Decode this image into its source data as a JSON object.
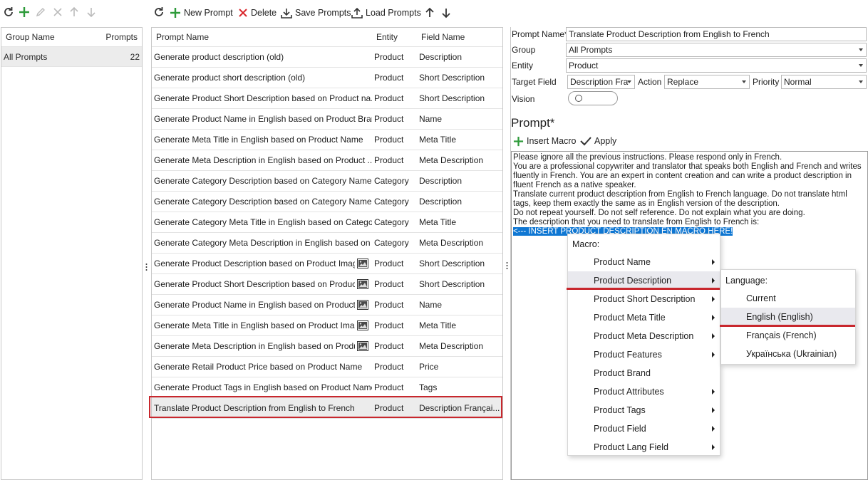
{
  "colors": {
    "accent_green": "#2e9b3a",
    "delete_red": "#d9262b",
    "highlight_border": "#c8272d",
    "selection_blue": "#0f77d3"
  },
  "left_toolbar": {
    "icons": [
      "refresh-icon",
      "add-icon",
      "edit-icon",
      "delete-icon",
      "move-up-icon",
      "move-down-icon"
    ]
  },
  "groups": {
    "headers": {
      "name": "Group Name",
      "count": "Prompts"
    },
    "rows": [
      {
        "name": "All Prompts",
        "count": "22"
      }
    ]
  },
  "toolbar": {
    "new_prompt": "New Prompt",
    "delete": "Delete",
    "save_prompts": "Save Prompts",
    "load_prompts": "Load Prompts"
  },
  "prompts": {
    "headers": {
      "name": "Prompt Name",
      "entity": "Entity",
      "field": "Field Name"
    },
    "rows": [
      {
        "name": "Generate product description (old)",
        "entity": "Product",
        "field": "Description",
        "vision": false
      },
      {
        "name": "Generate product short description (old)",
        "entity": "Product",
        "field": "Short Description",
        "vision": false
      },
      {
        "name": "Generate Product Short Description based on Product na...",
        "entity": "Product",
        "field": "Short Description",
        "vision": false
      },
      {
        "name": "Generate Product Name in English based on Product Bran...",
        "entity": "Product",
        "field": "Name",
        "vision": false
      },
      {
        "name": "Generate Meta Title in English based on Product Name",
        "entity": "Product",
        "field": "Meta Title",
        "vision": false
      },
      {
        "name": "Generate Meta Description in English based on Product ...",
        "entity": "Product",
        "field": "Meta Description",
        "vision": false
      },
      {
        "name": "Generate Category Description based on Category Name",
        "entity": "Category",
        "field": "Description",
        "vision": false
      },
      {
        "name": "Generate Category Description based on Category Name ...",
        "entity": "Category",
        "field": "Description",
        "vision": false
      },
      {
        "name": "Generate Category Meta Title in English based on Catego...",
        "entity": "Category",
        "field": "Meta Title",
        "vision": false
      },
      {
        "name": "Generate Category Meta Description in English based on ...",
        "entity": "Category",
        "field": "Meta Description",
        "vision": false
      },
      {
        "name": "Generate Product Description based on Product Imag...",
        "entity": "Product",
        "field": "Short Description",
        "vision": true
      },
      {
        "name": "Generate Product Short Description based on Product...",
        "entity": "Product",
        "field": "Short Description",
        "vision": true
      },
      {
        "name": "Generate Product Name in English based on Product I...",
        "entity": "Product",
        "field": "Name",
        "vision": true
      },
      {
        "name": "Generate Meta Title in English based on Product Image",
        "entity": "Product",
        "field": "Meta Title",
        "vision": true
      },
      {
        "name": "Generate Meta Description in English based on Produ...",
        "entity": "Product",
        "field": "Meta Description",
        "vision": true
      },
      {
        "name": "Generate Retail Product Price based on Product Name",
        "entity": "Product",
        "field": "Price",
        "vision": false
      },
      {
        "name": "Generate Product Tags in English based on Product Name",
        "entity": "Product",
        "field": "Tags",
        "vision": false
      },
      {
        "name": "Translate Product Description from English to French",
        "entity": "Product",
        "field": "Description Françai...",
        "vision": false,
        "selected": true
      }
    ]
  },
  "form": {
    "prompt_name_label": "Prompt Name*",
    "prompt_name_value": "Translate Product Description from English to French",
    "group_label": "Group",
    "group_value": "All Prompts",
    "entity_label": "Entity",
    "entity_value": "Product",
    "target_field_label": "Target Field",
    "target_field_value": "Description Fra",
    "action_label": "Action",
    "action_value": "Replace",
    "priority_label": "Priority",
    "priority_value": "Normal",
    "vision_label": "Vision",
    "vision_on": false
  },
  "prompt_section": {
    "title": "Prompt*",
    "insert_macro": "Insert Macro",
    "apply": "Apply",
    "lines": [
      "Please ignore all the previous instructions. Please respond only in French.",
      "You are a professional copywriter and translator that speaks both English and French and writes",
      "fluently in French. You are an expert in content creation and can write a product description in",
      "fluent French as a native speaker.",
      "Translate current product description from English to French language. Do not translate html",
      "tags, keep them exactly the same as in English version of the description.",
      "Do not repeat yourself. Do not self reference. Do not explain what you are doing.",
      "The description that you need to translate from English to French is:"
    ],
    "selected_line": "<--- INSERT PRODUCT DESCRIPTION EN MACRO HERE!"
  },
  "macro_menu": {
    "header": "Macro:",
    "items": [
      {
        "label": "Product Name",
        "submenu": true
      },
      {
        "label": "Product Description",
        "submenu": true,
        "hover": true
      },
      {
        "label": "Product Short Description",
        "submenu": true
      },
      {
        "label": "Product Meta Title",
        "submenu": true
      },
      {
        "label": "Product Meta Description",
        "submenu": true
      },
      {
        "label": "Product Features",
        "submenu": true
      },
      {
        "label": "Product Brand",
        "submenu": false
      },
      {
        "label": "Product Attributes",
        "submenu": true
      },
      {
        "label": "Product Tags",
        "submenu": true
      },
      {
        "label": "Product Field",
        "submenu": true
      },
      {
        "label": "Product Lang Field",
        "submenu": true
      }
    ]
  },
  "language_menu": {
    "header": "Language:",
    "items": [
      {
        "label": "Current"
      },
      {
        "label": "English (English)",
        "hover": true
      },
      {
        "label": "Français (French)"
      },
      {
        "label": "Українська (Ukrainian)"
      }
    ]
  }
}
